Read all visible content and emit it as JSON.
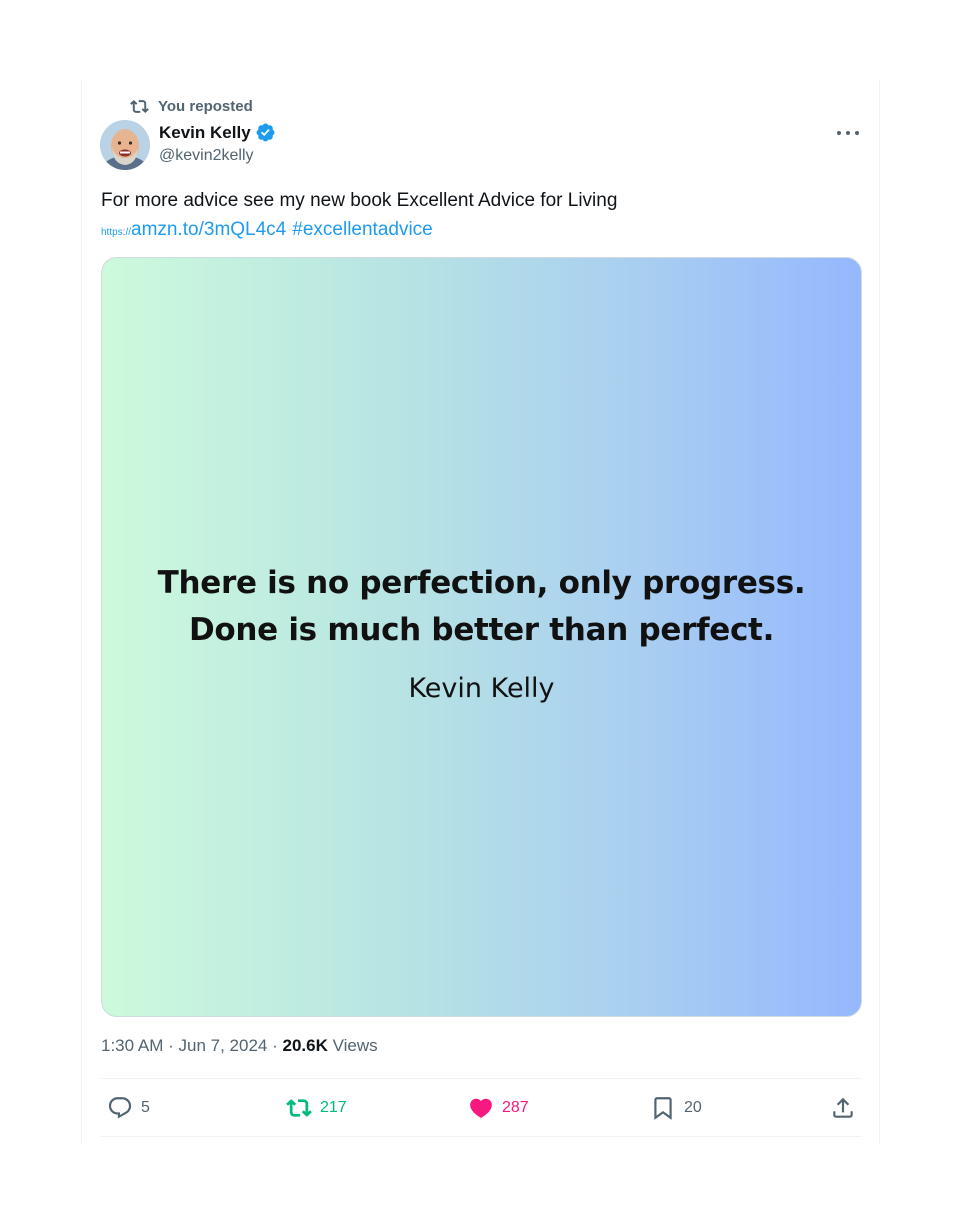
{
  "repost": {
    "icon": "repost-icon",
    "label": "You reposted"
  },
  "author": {
    "name": "Kevin Kelly",
    "handle": "@kevin2kelly",
    "verified": true
  },
  "post": {
    "text": "For more advice see my new book Excellent Advice for Living",
    "link_proto": "https://",
    "link": "amzn.to/3mQL4c4",
    "hashtag": "#excellentadvice"
  },
  "media": {
    "quote_line1": "There is no perfection, only progress.",
    "quote_line2": "Done is much better than perfect.",
    "quote_author": "Kevin Kelly",
    "gradient_colors": [
      "#cdfadc",
      "#95b8fe"
    ]
  },
  "meta": {
    "time": "1:30 AM",
    "separator": "·",
    "date": "Jun 7, 2024",
    "views_count": "20.6K",
    "views_label": "Views"
  },
  "actions": {
    "replies": "5",
    "reposts": "217",
    "likes": "287",
    "bookmarks": "20"
  },
  "colors": {
    "accent": "#1d9bf0",
    "retweet": "#00ba7c",
    "like": "#f91880",
    "muted": "#536471"
  }
}
